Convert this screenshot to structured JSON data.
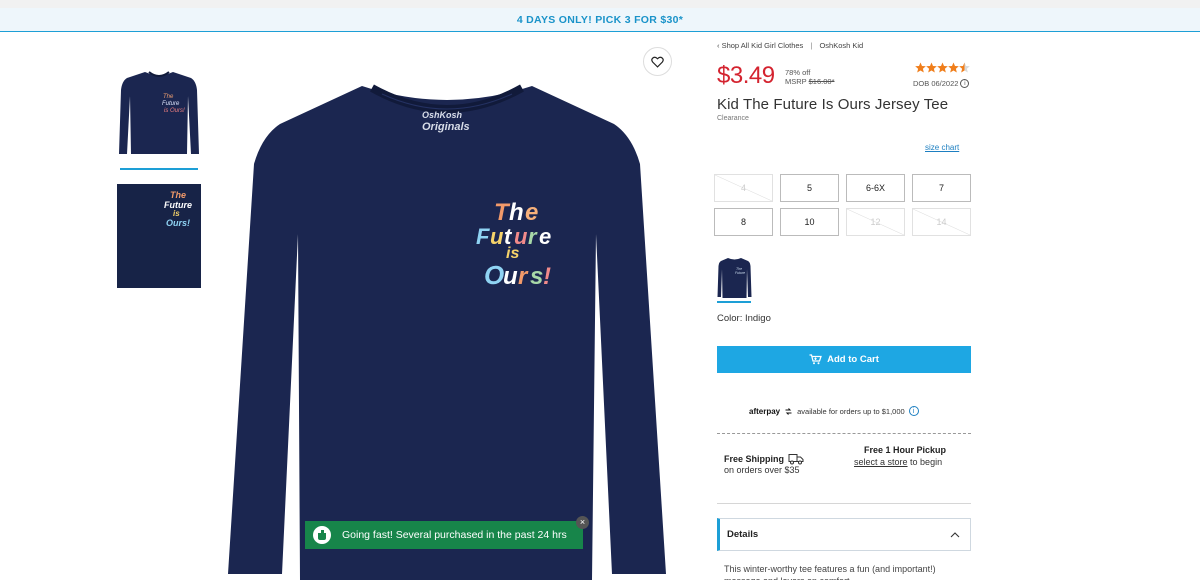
{
  "promo": {
    "text": "4 DAYS ONLY! PICK 3 FOR $30*"
  },
  "gallery": {
    "thumb1_alt": "Front view thumbnail",
    "thumb2_alt": "Graphic detail thumbnail",
    "graphic_lines": [
      "The",
      "Future",
      "is",
      "Ours!"
    ],
    "brand_tag": "OshKosh Originals"
  },
  "toast": {
    "message": "Going fast! Several purchased in the past 24 hrs",
    "close": "×"
  },
  "breadcrumb": {
    "back": "‹ Shop All Kid Girl Clothes",
    "separator": "|",
    "brand": "OshKosh Kid"
  },
  "product": {
    "price": "$3.49",
    "discount": "78% off",
    "msrp_label": "MSRP",
    "msrp_value": "$16.00*",
    "rating": 4.5,
    "dob": "DOB 06/2022",
    "title": "Kid The Future Is Ours Jersey Tee",
    "badge": "Clearance"
  },
  "size_chart": "size chart",
  "sizes": [
    {
      "label": "4",
      "available": false
    },
    {
      "label": "5",
      "available": true
    },
    {
      "label": "6-6X",
      "available": true
    },
    {
      "label": "7",
      "available": true
    },
    {
      "label": "8",
      "available": true
    },
    {
      "label": "10",
      "available": true
    },
    {
      "label": "12",
      "available": false
    },
    {
      "label": "14",
      "available": false
    }
  ],
  "color": {
    "label": "Color: Indigo",
    "swatch_hex": "#1b2650"
  },
  "cart": {
    "label": "Add to Cart"
  },
  "afterpay": {
    "logo": "afterpay",
    "text": "available for orders up to $1,000"
  },
  "shipping": {
    "title": "Free Shipping",
    "sub": "on orders over $35"
  },
  "pickup": {
    "title": "Free 1 Hour Pickup",
    "link": "select a store",
    "sub": "to begin"
  },
  "details": {
    "label": "Details"
  },
  "description": "This winter-worthy tee features a fun (and important!) message and layers on comfort.",
  "colors": {
    "accent": "#1ea7e3",
    "price_red": "#d4232f",
    "toast_green": "#17854a",
    "shirt_navy": "#1b2650"
  }
}
